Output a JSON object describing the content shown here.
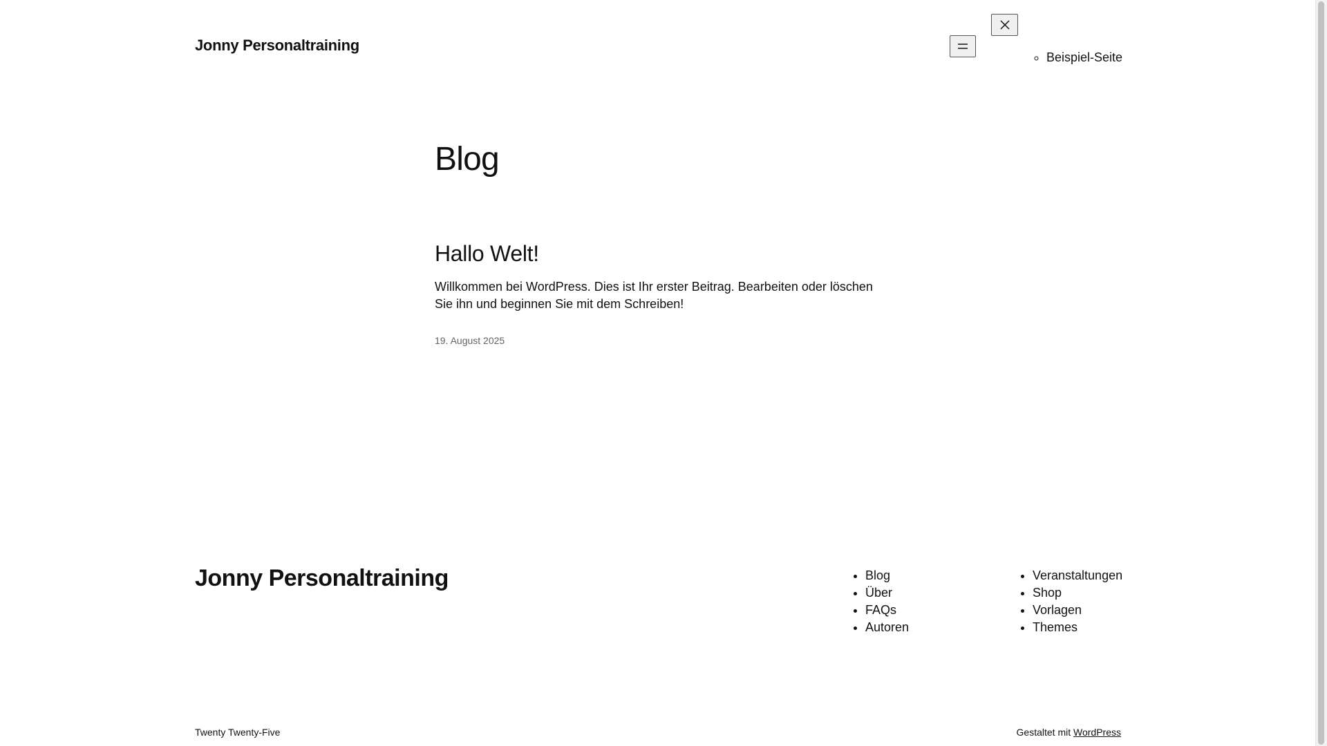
{
  "header": {
    "site_title": "Jonny Personaltraining",
    "menu_open_icon": "hamburger-menu-icon",
    "menu_close_icon": "close-icon",
    "nav_items": [
      {
        "label": "Beispiel-Seite"
      }
    ]
  },
  "main": {
    "page_heading": "Blog",
    "posts": [
      {
        "title": "Hallo Welt!",
        "excerpt": "Willkommen bei WordPress. Dies ist Ihr erster Beitrag. Bearbeiten oder löschen Sie ihn und beginnen Sie mit dem Schreiben!",
        "date": "19. August 2025"
      }
    ]
  },
  "footer": {
    "site_title": "Jonny Personaltraining",
    "menu_1": [
      {
        "label": "Blog"
      },
      {
        "label": "Über"
      },
      {
        "label": "FAQs"
      },
      {
        "label": "Autoren"
      }
    ],
    "menu_2": [
      {
        "label": "Veranstaltungen"
      },
      {
        "label": "Shop"
      },
      {
        "label": "Vorlagen"
      },
      {
        "label": "Themes"
      }
    ],
    "theme_name": "Twenty Twenty-Five",
    "credit_prefix": "Gestaltet mit",
    "credit_link": "WordPress"
  },
  "colors": {
    "text": "#111111",
    "muted": "#636363",
    "background": "#ffffff"
  }
}
